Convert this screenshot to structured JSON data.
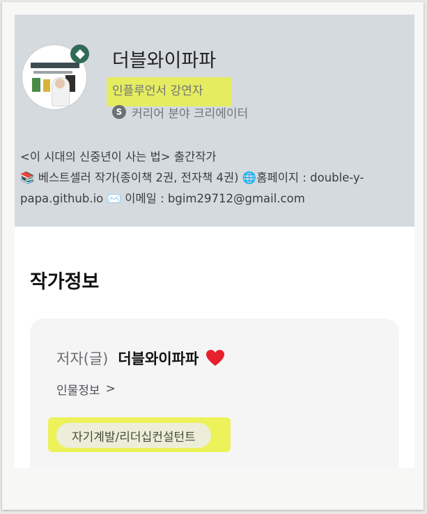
{
  "profile": {
    "name": "더블와이파파",
    "role": "인플루언서 강연자",
    "creator_badge": "S",
    "creator_label": "커리어 분야 크리에이터",
    "bio_lines": [
      "<이 시대의 신중년이 사는 법> 출간작가",
      "📚 베스트셀러 작가(종이책 2권, 전자책 4권) 🌐홈페이지 : double-y-",
      "papa.github.io ✉️ 이메일 : bgim29712@gmail.com"
    ]
  },
  "author_info": {
    "section_title": "작가정보",
    "author_label": "저자(글)",
    "author_name": "더블와이파파",
    "profile_link": "인물정보",
    "profile_link_chevron": ">",
    "tag": "자기계발/리더십컨설턴트"
  },
  "colors": {
    "header_bg": "#d5dadf",
    "highlight": "#e8ef4a",
    "heart": "#e8202e",
    "badge": "#2f6b55"
  }
}
